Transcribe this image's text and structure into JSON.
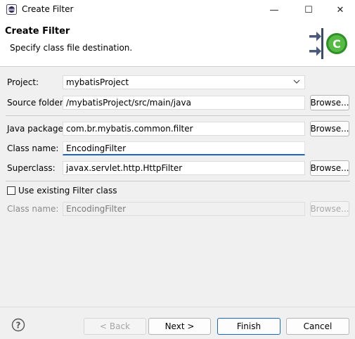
{
  "window": {
    "title": "Create Filter",
    "minimize_glyph": "—",
    "maximize_glyph": "☐",
    "close_glyph": "✕"
  },
  "banner": {
    "title": "Create Filter",
    "subtitle": "Specify class file destination.",
    "icon": "new-class-wizard-icon",
    "icon_badge_letter": "C"
  },
  "form": {
    "project": {
      "label": "Project:",
      "value": "mybatisProject"
    },
    "source_folder": {
      "label": "Source folder:",
      "value": "/mybatisProject/src/main/java",
      "browse_label": "Browse..."
    },
    "java_package": {
      "label": "Java package:",
      "value": "com.br.mybatis.common.filter",
      "browse_label": "Browse..."
    },
    "class_name": {
      "label": "Class name:",
      "value": "EncodingFilter"
    },
    "superclass": {
      "label": "Superclass:",
      "value": "javax.servlet.http.HttpFilter",
      "browse_label": "Browse..."
    },
    "use_existing": {
      "label": "Use existing Filter class",
      "checked": false
    },
    "existing_class_name": {
      "label": "Class name:",
      "value": "EncodingFilter",
      "browse_label": "Browse..."
    }
  },
  "footer": {
    "help_icon": "help-icon",
    "back_label": "< Back",
    "next_label": "Next >",
    "finish_label": "Finish",
    "cancel_label": "Cancel"
  },
  "colors": {
    "accent": "#1a66c4",
    "badge_green": "#3aa12f"
  }
}
